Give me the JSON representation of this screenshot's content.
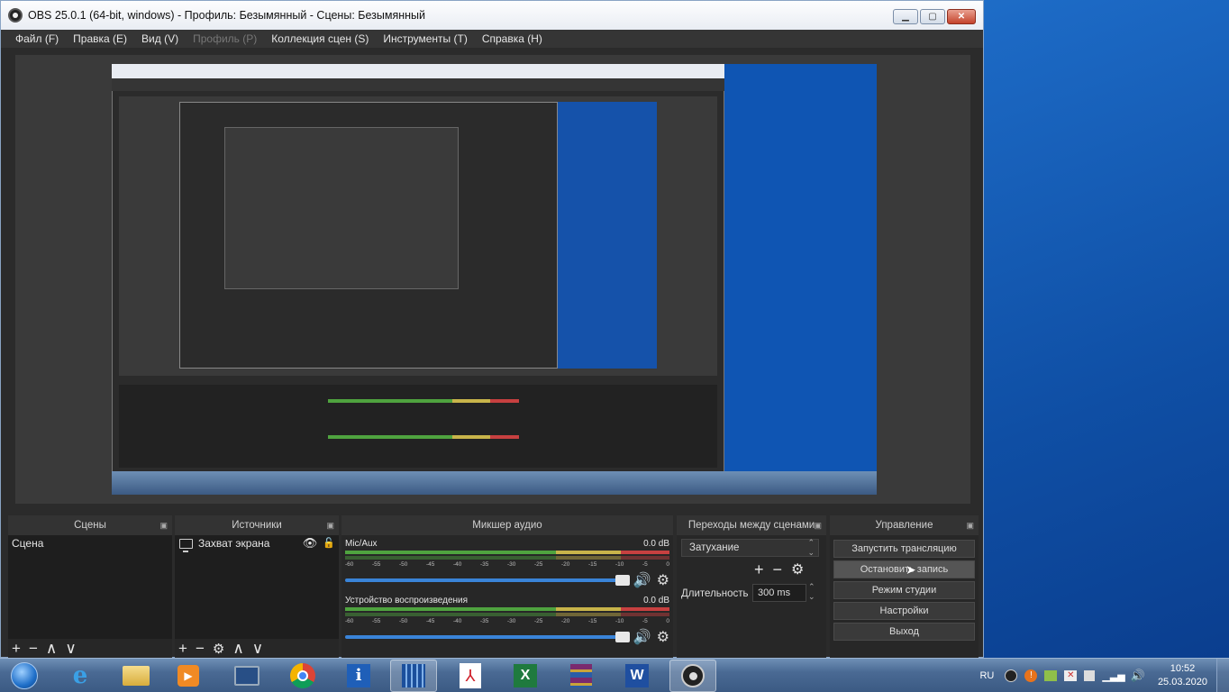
{
  "window": {
    "title": "OBS 25.0.1 (64-bit, windows) - Профиль: Безымянный - Сцены: Безымянный",
    "minimize_glyph": "▁",
    "maximize_glyph": "▢",
    "close_glyph": "✕"
  },
  "menu": [
    "Файл (F)",
    "Правка (E)",
    "Вид (V)",
    "Профиль (P)",
    "Коллекция сцен (S)",
    "Инструменты (T)",
    "Справка (H)"
  ],
  "menu_disabled_index": 3,
  "scenes": {
    "title": "Сцены",
    "items": [
      "Сцена"
    ]
  },
  "sources": {
    "title": "Источники",
    "items": [
      {
        "name": "Захват экрана",
        "visible": true,
        "locked": false
      }
    ]
  },
  "mixer": {
    "title": "Микшер аудио",
    "channels": [
      {
        "name": "Mic/Aux",
        "db": "0.0 dB",
        "level": 0.87
      },
      {
        "name": "Устройство воспроизведения",
        "db": "0.0 dB",
        "level": 0.87
      }
    ],
    "ticks": [
      "-60",
      "-55",
      "-50",
      "-45",
      "-40",
      "-35",
      "-30",
      "-25",
      "-20",
      "-15",
      "-10",
      "-5",
      "0"
    ]
  },
  "transitions": {
    "title": "Переходы между сценами",
    "selected": "Затухание",
    "duration_label": "Длительность",
    "duration_value": "300 ms"
  },
  "controls": {
    "title": "Управление",
    "buttons": [
      "Запустить трансляцию",
      "Остановить запись",
      "Режим студии",
      "Настройки",
      "Выход"
    ],
    "active_index": 1
  },
  "toolbar_glyphs": {
    "add": "+",
    "remove": "−",
    "up": "∧",
    "down": "∨",
    "settings": "⚙"
  },
  "taskbar": {
    "apps": [
      "ie-icon",
      "explorer-icon",
      "media-player-icon",
      "remote-desktop-icon",
      "chrome-icon",
      "info-icon",
      "calculator-icon",
      "pdf-icon",
      "excel-icon",
      "winrar-icon",
      "word-icon",
      "obs-icon"
    ],
    "active_app": "obs-icon",
    "language": "RU",
    "time": "10:52",
    "date": "25.03.2020"
  },
  "colors": {
    "obs_bg": "#2b2b2b",
    "panel": "#272727",
    "meter_green": "#4fa33f",
    "meter_yellow": "#c8b44a",
    "meter_red": "#c74040",
    "volume_blue": "#3a84d8",
    "desktop_blue": "#1c69c4"
  }
}
